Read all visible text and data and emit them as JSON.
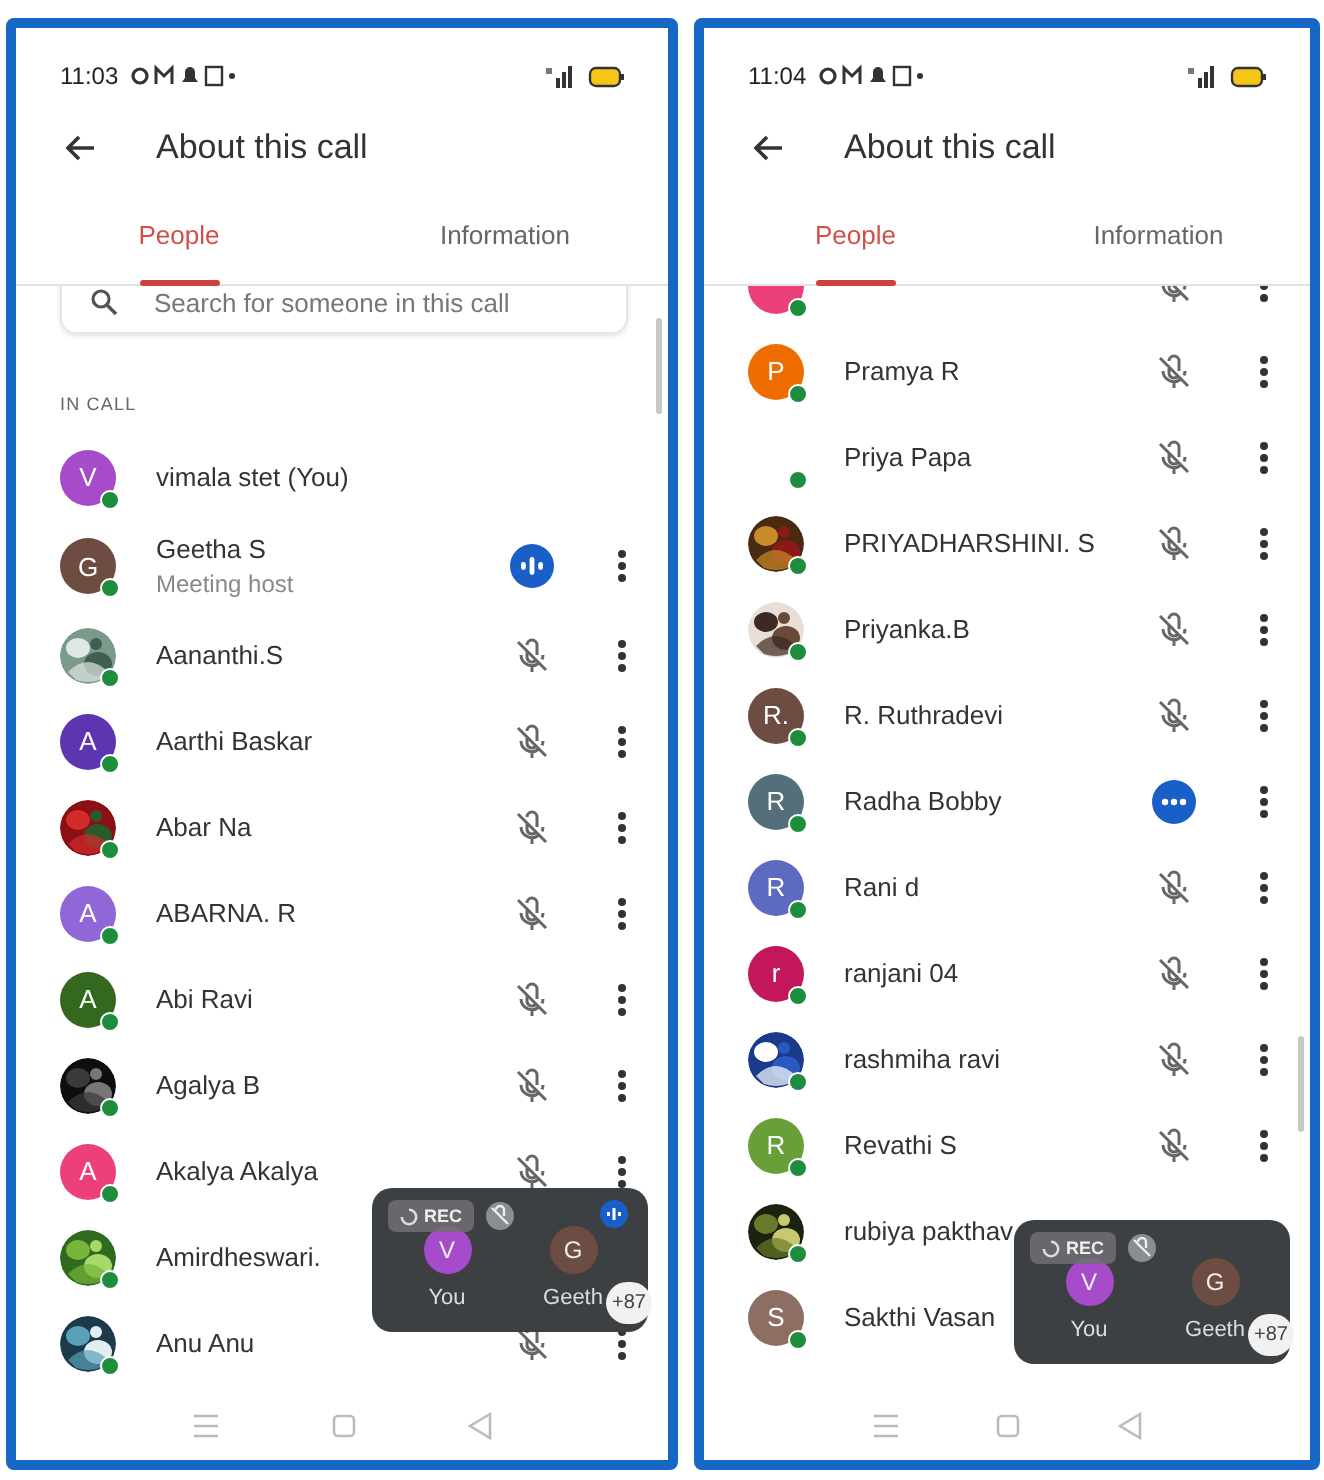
{
  "screens": [
    {
      "status_time": "11:03",
      "title": "About this call",
      "tabs": [
        {
          "label": "People",
          "selected": true
        },
        {
          "label": "Information",
          "selected": false
        }
      ],
      "search": {
        "placeholder": "Search for someone in this call"
      },
      "section": "IN CALL",
      "participants": [
        {
          "name": "vimala stet (You)",
          "avatar": {
            "kind": "letter",
            "letter": "V",
            "color": "#a64bc9"
          },
          "kind": "none",
          "menu": false
        },
        {
          "name": "Geetha S",
          "subtitle": "Meeting host",
          "avatar": {
            "kind": "letter",
            "letter": "G",
            "color": "#6d4c41"
          },
          "kind": "talking",
          "menu": true
        },
        {
          "name": "Aananthi.S",
          "kind": "muted",
          "menu": true
        },
        {
          "name": "Aarthi Baskar",
          "avatar": {
            "kind": "letter",
            "letter": "A",
            "color": "#5e35b1"
          },
          "kind": "muted",
          "menu": true
        },
        {
          "name": "Abar Na",
          "kind": "muted",
          "menu": true
        },
        {
          "name": "ABARNA. R",
          "avatar": {
            "kind": "letter",
            "letter": "A",
            "color": "#9067d6"
          },
          "kind": "muted",
          "menu": true
        },
        {
          "name": "Abi Ravi",
          "avatar": {
            "kind": "letter",
            "letter": "A",
            "color": "#33691e"
          },
          "kind": "muted",
          "menu": true
        },
        {
          "name": "Agalya B",
          "kind": "muted",
          "menu": true
        },
        {
          "name": "Akalya Akalya",
          "avatar": {
            "kind": "letter",
            "letter": "A",
            "color": "#ec407a"
          },
          "kind": "muted",
          "menu": true
        },
        {
          "name": "Amirdheswari.",
          "kind": "none",
          "menu": false
        },
        {
          "name": "Anu Anu",
          "kind": "muted",
          "menu": true
        }
      ],
      "overlay": {
        "rec": "REC",
        "spinner": true,
        "more": "+87",
        "tiles": [
          {
            "label": "You",
            "letter": "V",
            "color": "#a64bc9",
            "talking": false
          },
          {
            "label": "Geeth",
            "letter": "G",
            "color": "#6d4c41",
            "talking": true
          }
        ]
      }
    },
    {
      "status_time": "11:04",
      "title": "About this call",
      "tabs": [
        {
          "label": "People",
          "selected": true
        },
        {
          "label": "Information",
          "selected": false
        }
      ],
      "participants": [
        {
          "avatar": {
            "kind": "letter",
            "color": "#ec407a"
          },
          "kind": "muted",
          "menu": true
        },
        {
          "name": "Pramya R",
          "avatar": {
            "kind": "letter",
            "letter": "P",
            "color": "#ef6c00"
          },
          "kind": "muted",
          "menu": true
        },
        {
          "name": "Priya Papa",
          "avatar": {
            "kind": "none"
          },
          "kind": "muted",
          "menu": true
        },
        {
          "name": "PRIYADHARSHINI. S",
          "kind": "muted",
          "menu": true
        },
        {
          "name": "Priyanka.B",
          "kind": "muted",
          "menu": true
        },
        {
          "name": "R. Ruthradevi",
          "avatar": {
            "kind": "letter",
            "letter": "R.",
            "color": "#6d4c41"
          },
          "kind": "muted",
          "menu": true
        },
        {
          "name": "Radha Bobby",
          "avatar": {
            "kind": "letter",
            "letter": "R",
            "color": "#546e7a"
          },
          "kind": "busy",
          "menu": true
        },
        {
          "name": "Rani d",
          "avatar": {
            "kind": "letter",
            "letter": "R",
            "color": "#5c6bc0"
          },
          "kind": "muted",
          "menu": true
        },
        {
          "name": "ranjani 04",
          "avatar": {
            "kind": "letter",
            "letter": "r",
            "color": "#c2185b"
          },
          "kind": "muted",
          "menu": true
        },
        {
          "name": "rashmiha ravi",
          "kind": "muted",
          "menu": true
        },
        {
          "name": "Revathi S",
          "avatar": {
            "kind": "letter",
            "letter": "R",
            "color": "#689f38"
          },
          "kind": "muted",
          "menu": true
        },
        {
          "name": "rubiya pakthav",
          "kind": "none",
          "menu": false
        },
        {
          "name": "Sakthi Vasan",
          "avatar": {
            "kind": "letter",
            "letter": "S",
            "color": "#8d6e63"
          },
          "kind": "none",
          "menu": false
        }
      ],
      "overlay": {
        "rec": "REC",
        "spinner": true,
        "more": "+87",
        "tiles": [
          {
            "label": "You",
            "letter": "V",
            "color": "#a64bc9",
            "talking": false
          },
          {
            "label": "Geeth",
            "letter": "G",
            "color": "#6d4c41",
            "talking": false
          }
        ]
      }
    }
  ]
}
